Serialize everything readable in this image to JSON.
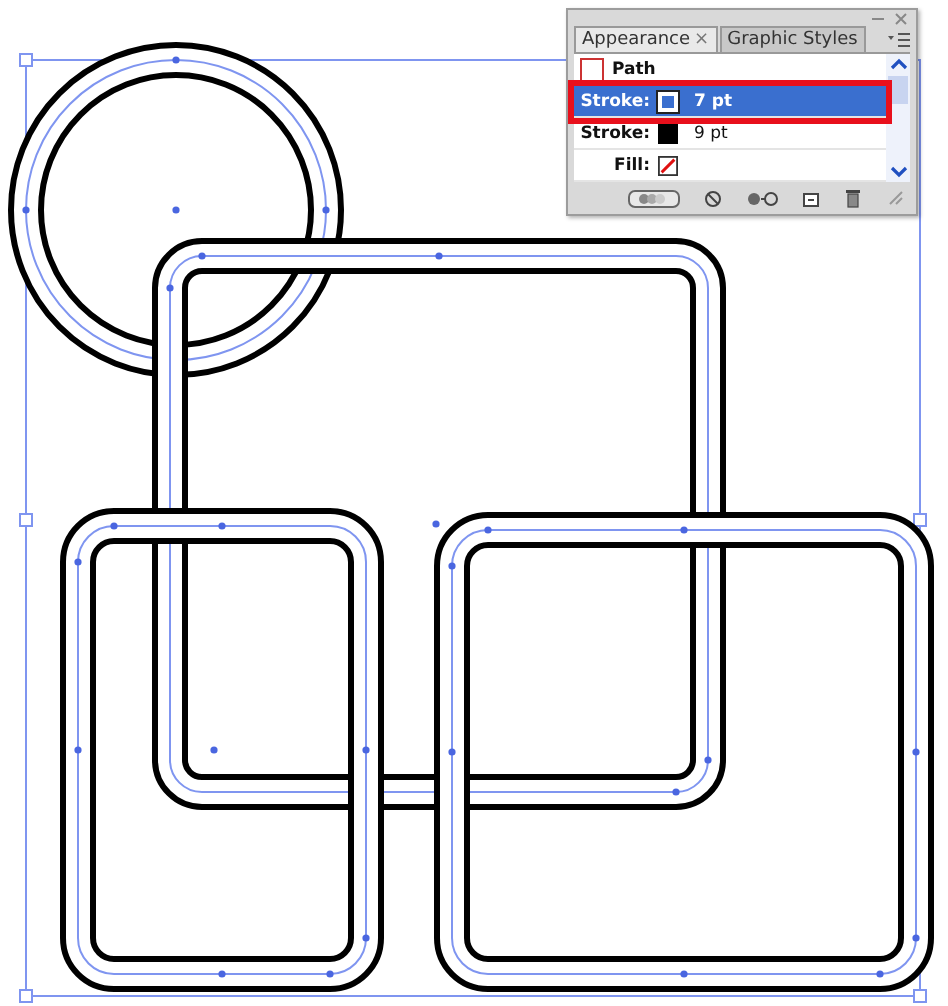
{
  "panel": {
    "tabs": [
      {
        "label": "Appearance",
        "close": "×",
        "selected": true
      },
      {
        "label": "Graphic Styles",
        "selected": false
      }
    ],
    "rows": [
      {
        "kind": "header",
        "label": "Path",
        "selected": false,
        "highlighted": false
      },
      {
        "kind": "attribute",
        "label": "Stroke:",
        "swatch": {
          "kind": "outline"
        },
        "value": "7 pt",
        "selected": true,
        "highlighted": true
      },
      {
        "kind": "attribute",
        "label": "Stroke:",
        "swatch": {
          "kind": "solid"
        },
        "value": "9 pt",
        "selected": false,
        "highlighted": false
      },
      {
        "kind": "attribute",
        "label": "Fill:",
        "swatch": {
          "kind": "none"
        },
        "selected": false,
        "highlighted": false
      }
    ]
  }
}
